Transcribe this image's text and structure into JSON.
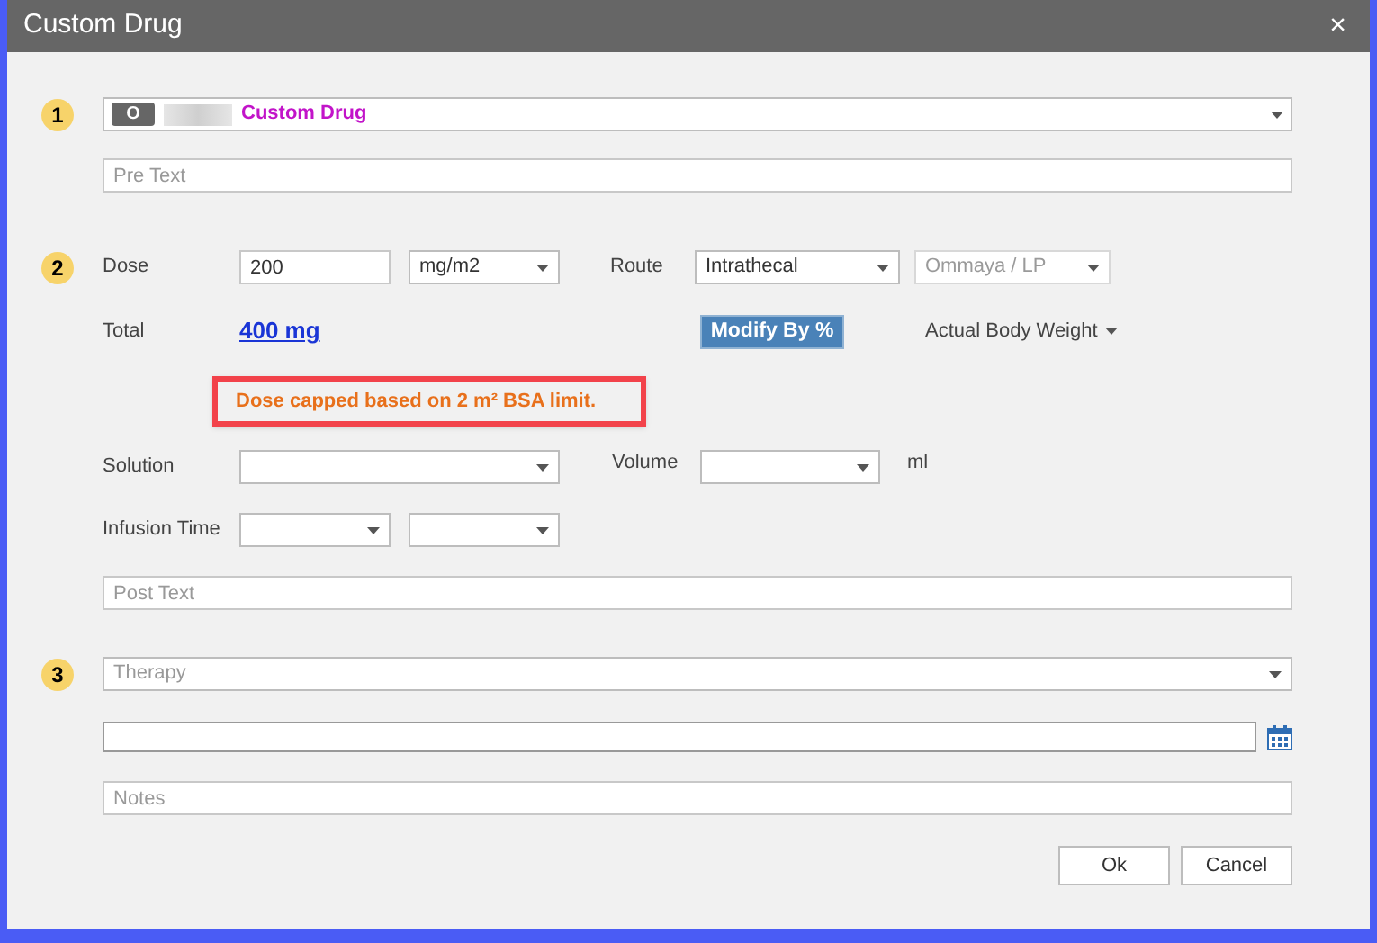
{
  "window": {
    "title": "Custom Drug",
    "close": "×"
  },
  "step_1": {
    "number": "1",
    "drug_select": {
      "badge": "O",
      "value": "Custom Drug"
    },
    "pre_text": {
      "placeholder": "Pre Text"
    }
  },
  "step_2": {
    "number": "2",
    "dose": {
      "label": "Dose",
      "value": "200",
      "unit": "mg/m2"
    },
    "route": {
      "label": "Route",
      "value": "Intrathecal",
      "site": {
        "value": "Ommaya / LP",
        "disabled": true
      }
    },
    "total": {
      "label": "Total",
      "value": "400 mg"
    },
    "modify_button": "Modify By %",
    "weight_menu": "Actual Body Weight",
    "warning": "Dose capped based on 2 m² BSA limit.",
    "solution": {
      "label": "Solution"
    },
    "volume": {
      "label": "Volume",
      "unit": "ml"
    },
    "infusion_time": {
      "label": "Infusion Time"
    },
    "post_text": {
      "placeholder": "Post Text"
    }
  },
  "step_3": {
    "number": "3",
    "therapy": {
      "placeholder": "Therapy"
    },
    "notes": {
      "placeholder": "Notes"
    }
  },
  "buttons": [
    "Ok",
    "Cancel"
  ]
}
